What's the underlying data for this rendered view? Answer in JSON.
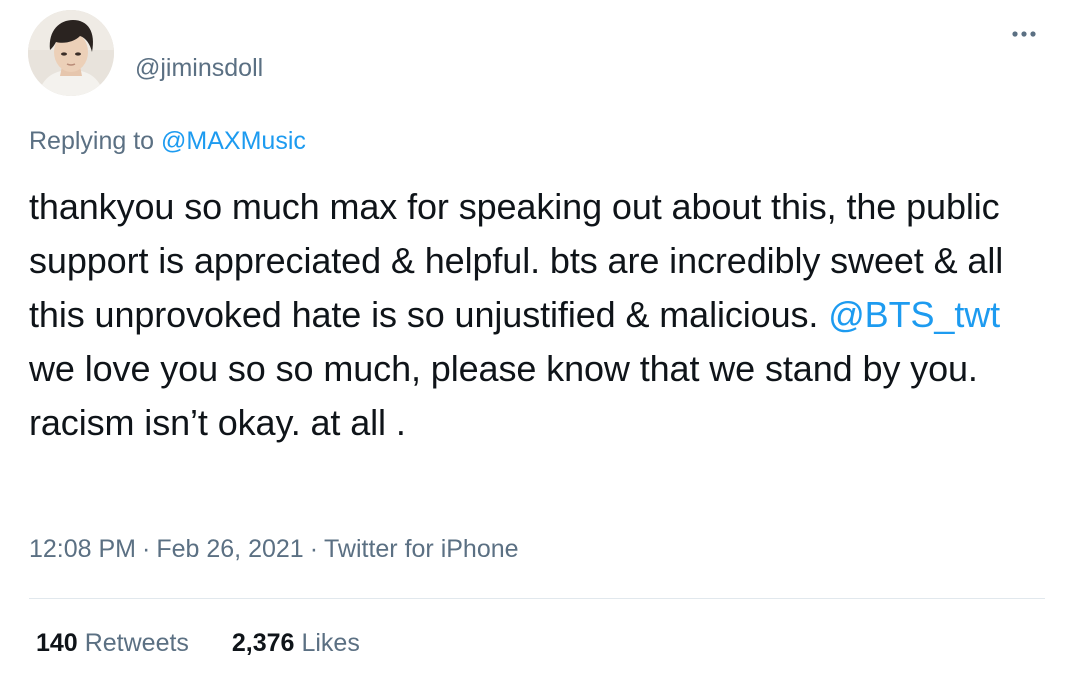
{
  "author": {
    "handle": "@jiminsdoll",
    "avatar_icon": "profile-photo"
  },
  "menu": {
    "icon": "more-horizontal-icon"
  },
  "reply": {
    "prefix": "Replying to",
    "mention": "@MAXMusic"
  },
  "tweet": {
    "text_part1": "thankyou so much max for speaking out about this, the public support is appreciated & helpful. bts are incredibly sweet & all this unprovoked hate is so unjustified & malicious. ",
    "mention": "@BTS_twt",
    "text_part2": " we love you so so much, please know that we stand by you. racism isn’t okay.  at all ."
  },
  "meta": {
    "time": "12:08 PM",
    "separator": "·",
    "date": "Feb 26, 2021",
    "source": "Twitter for iPhone"
  },
  "stats": {
    "retweets_count": "140",
    "retweets_label": "Retweets",
    "likes_count": "2,376",
    "likes_label": "Likes"
  },
  "colors": {
    "text": "#0f1419",
    "secondary": "#5b7083",
    "link": "#1d9bf0",
    "divider": "#e1e8ed"
  }
}
